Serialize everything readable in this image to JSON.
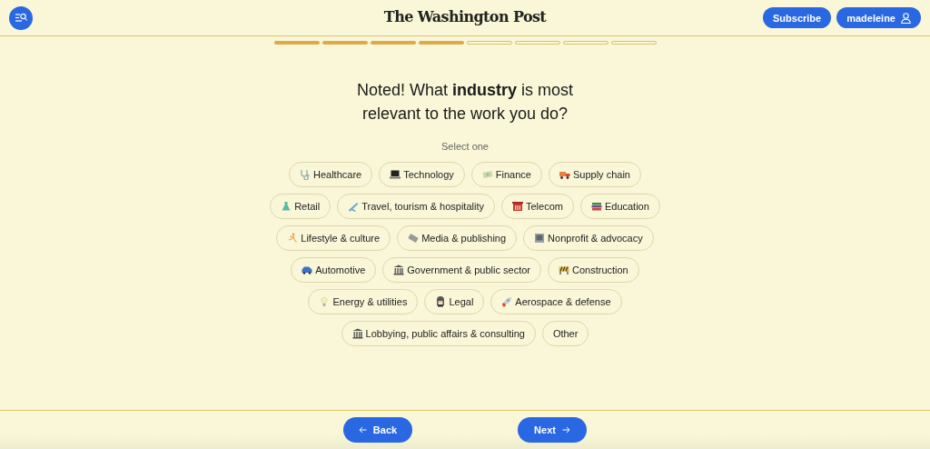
{
  "header": {
    "logo": "The Washington Post",
    "subscribe": "Subscribe",
    "account": "madeleine"
  },
  "progress": [
    {
      "completed": true
    },
    {
      "completed": true
    },
    {
      "completed": true
    },
    {
      "completed": true
    },
    {
      "completed": false
    },
    {
      "completed": false
    },
    {
      "completed": false
    },
    {
      "completed": false
    }
  ],
  "question": "Noted! What **industry** is most relevant to the work you do?",
  "hint": "Select one",
  "option_rows": [
    [
      {
        "label": "Healthcare",
        "selected": false
      },
      {
        "label": "Technology",
        "selected": false
      },
      {
        "label": "Finance",
        "selected": false
      },
      {
        "label": "Supply chain",
        "selected": false
      }
    ],
    [
      {
        "label": "Retail",
        "selected": false
      },
      {
        "label": "Travel, tourism & hospitality",
        "selected": false
      },
      {
        "label": "Telecom",
        "selected": false
      },
      {
        "label": "Education",
        "selected": false
      }
    ],
    [
      {
        "label": "Lifestyle & culture",
        "selected": false
      },
      {
        "label": "Media & publishing",
        "selected": false
      },
      {
        "label": "Nonprofit & advocacy",
        "selected": false
      }
    ],
    [
      {
        "label": "Automotive",
        "selected": false
      },
      {
        "label": "Government & public sector",
        "selected": false
      },
      {
        "label": "Construction",
        "selected": false
      }
    ],
    [
      {
        "label": "Energy & utilities",
        "selected": false
      },
      {
        "label": "Legal",
        "selected": false
      },
      {
        "label": "Aerospace & defense",
        "selected": false
      }
    ],
    [
      {
        "label": "Lobbying, public affairs & consulting",
        "selected": false
      },
      {
        "label": "Other",
        "selected": false
      }
    ]
  ],
  "footer": {
    "back": "Back",
    "next": "Next"
  }
}
